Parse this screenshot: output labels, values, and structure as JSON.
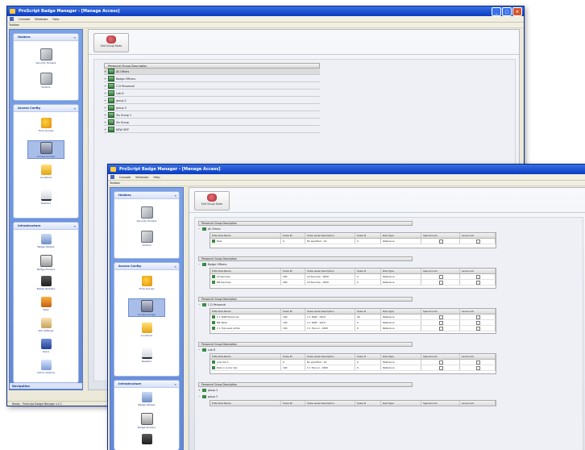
{
  "window_back": {
    "title": "ProScript Badge Manager - [Manage Access]",
    "menu": [
      "Console",
      "Windows",
      "Help"
    ],
    "subbar": "Toolbox",
    "status_text": "Ready - ProScript Badge Manager v1.0",
    "nav_footer": "Navigation"
  },
  "window_front": {
    "title": "ProScript Badge Manager - [Manage Access]",
    "menu": [
      "Console",
      "Windows",
      "Help"
    ],
    "subbar": "Toolbox"
  },
  "sidebar": {
    "sections": [
      {
        "title": "Holders",
        "items": [
          {
            "label": "Security Holders",
            "icon": "holder-icon"
          },
          {
            "label": "Visitors",
            "icon": "visitor-icon"
          }
        ]
      },
      {
        "title": "Access Config",
        "items": [
          {
            "label": "Time Groups",
            "icon": "time-icon"
          },
          {
            "label": "Access Groups",
            "icon": "access-icon"
          },
          {
            "label": "Locations",
            "icon": "location-icon"
          },
          {
            "label": "Readers",
            "icon": "reader-icon"
          }
        ]
      },
      {
        "title": "Infrastructure",
        "items": [
          {
            "label": "Badge Models",
            "icon": "badge-icon"
          },
          {
            "label": "Badge Printers",
            "icon": "printer-icon"
          },
          {
            "label": "Badge Readers",
            "icon": "reader2-icon"
          },
          {
            "label": "Sites",
            "icon": "site-icon"
          },
          {
            "label": "Site Settings",
            "icon": "settings-icon"
          },
          {
            "label": "Users",
            "icon": "users-icon"
          },
          {
            "label": "Admin Options",
            "icon": "admin-icon"
          }
        ]
      }
    ]
  },
  "toolbar": {
    "button_label": "Edit Group Roles"
  },
  "tree": {
    "header": "Personnel Group Description",
    "groups": [
      "All Others",
      "Badge Officers",
      "C D Personnel",
      "Lab D",
      "group 2",
      "group 3",
      "Vis Group 1",
      "Vis Group",
      "NEW GRP"
    ]
  },
  "detail": {
    "group_header": "Personnel Group Description",
    "columns": [
      "Edits Role Name",
      "Scale ID",
      "Scale Level Description",
      "Scale #",
      "Role Type",
      "Special Lock",
      "Level Lock"
    ],
    "blocks": [
      {
        "name": "All Others",
        "rows": [
          {
            "role": "Role",
            "id": "0",
            "desc": "No specified - All",
            "num": "0",
            "type": "Reference"
          }
        ]
      },
      {
        "name": "Badge Officers",
        "rows": [
          {
            "role": "All Services",
            "id": "200",
            "desc": "All Services - 2000",
            "num": "0",
            "type": "Reference"
          },
          {
            "role": "MR Services",
            "id": "200",
            "desc": "All Services - 2000",
            "num": "0",
            "type": "Reference"
          }
        ]
      },
      {
        "name": "C D Personnel",
        "rows": [
          {
            "role": "C 1 Staff Personnel",
            "id": "100",
            "desc": "C 1 Staff - 1010",
            "num": "99",
            "type": "Reference"
          },
          {
            "role": "MR Temp",
            "id": "100",
            "desc": "C 1 Staff - 1010",
            "num": "0",
            "type": "Reference"
          },
          {
            "role": "C 1 Top Level Admin",
            "id": "100",
            "desc": "C 1 Top Lvl - 1000",
            "num": "0",
            "type": "Reference"
          }
        ]
      },
      {
        "name": "Lab D",
        "rows": [
          {
            "role": "role role 1",
            "id": "0",
            "desc": "No specified - All",
            "num": "0",
            "type": "Reference"
          },
          {
            "role": "Role in a role role",
            "id": "100",
            "desc": "C 1 Top Lvl - 1000",
            "num": "0",
            "type": "Reference"
          }
        ]
      },
      {
        "name": "group 2",
        "rows": []
      },
      {
        "name": "group 3",
        "rows": []
      }
    ]
  }
}
